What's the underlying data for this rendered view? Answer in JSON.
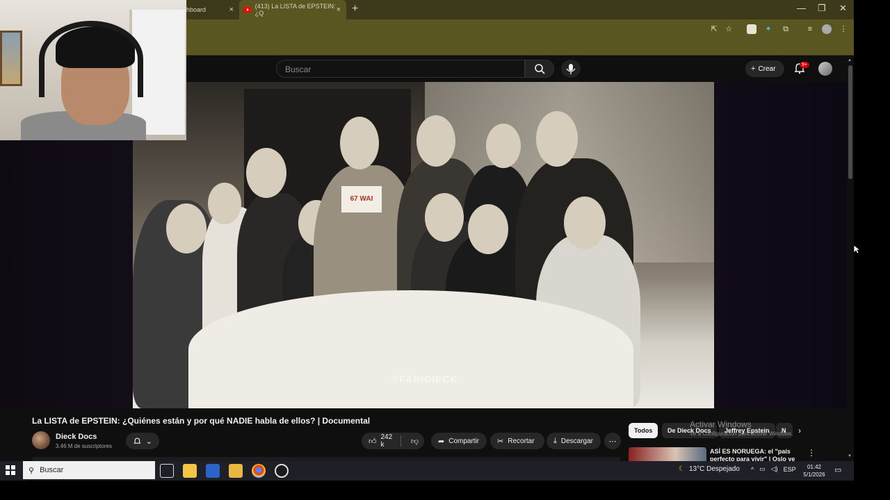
{
  "browser": {
    "tabs": [
      {
        "label": "hboard",
        "close": "×"
      },
      {
        "label": "(413) La LISTA de EPSTEIN: ¿Q",
        "close": "×"
      }
    ],
    "new_tab": "+",
    "window_controls": {
      "minimize": "—",
      "restore": "❐",
      "close": "✕"
    }
  },
  "youtube": {
    "search_placeholder": "Buscar",
    "create_label": "Crear",
    "notif_badge": "9+"
  },
  "video": {
    "sign_text": "67 WAI",
    "watermark": "©FARIDIECK",
    "title": "La LISTA de EPSTEIN: ¿Quiénes están y por qué NADIE habla de ellos? | Documental"
  },
  "channel": {
    "name": "Dieck Docs",
    "subscribers": "3.46 M de suscriptores"
  },
  "actions": {
    "likes": "242 k",
    "share": "Compartir",
    "clip": "Recortar",
    "download": "Descargar"
  },
  "chips": [
    "Todos",
    "De Dieck Docs",
    "Jeffrey Epstein",
    "N"
  ],
  "activation": {
    "title": "Activar Windows",
    "subtitle": "Ve a Configuración para activar Windows."
  },
  "recommendation": {
    "title": "ASÍ ES NORUEGA: el \"país perfecto para vivir\" | Oslo ye"
  },
  "taskbar": {
    "search_label": "Buscar",
    "weather": "13°C  Despejado",
    "lang": "ESP",
    "time": "01:42",
    "date": "5/1/2026"
  }
}
